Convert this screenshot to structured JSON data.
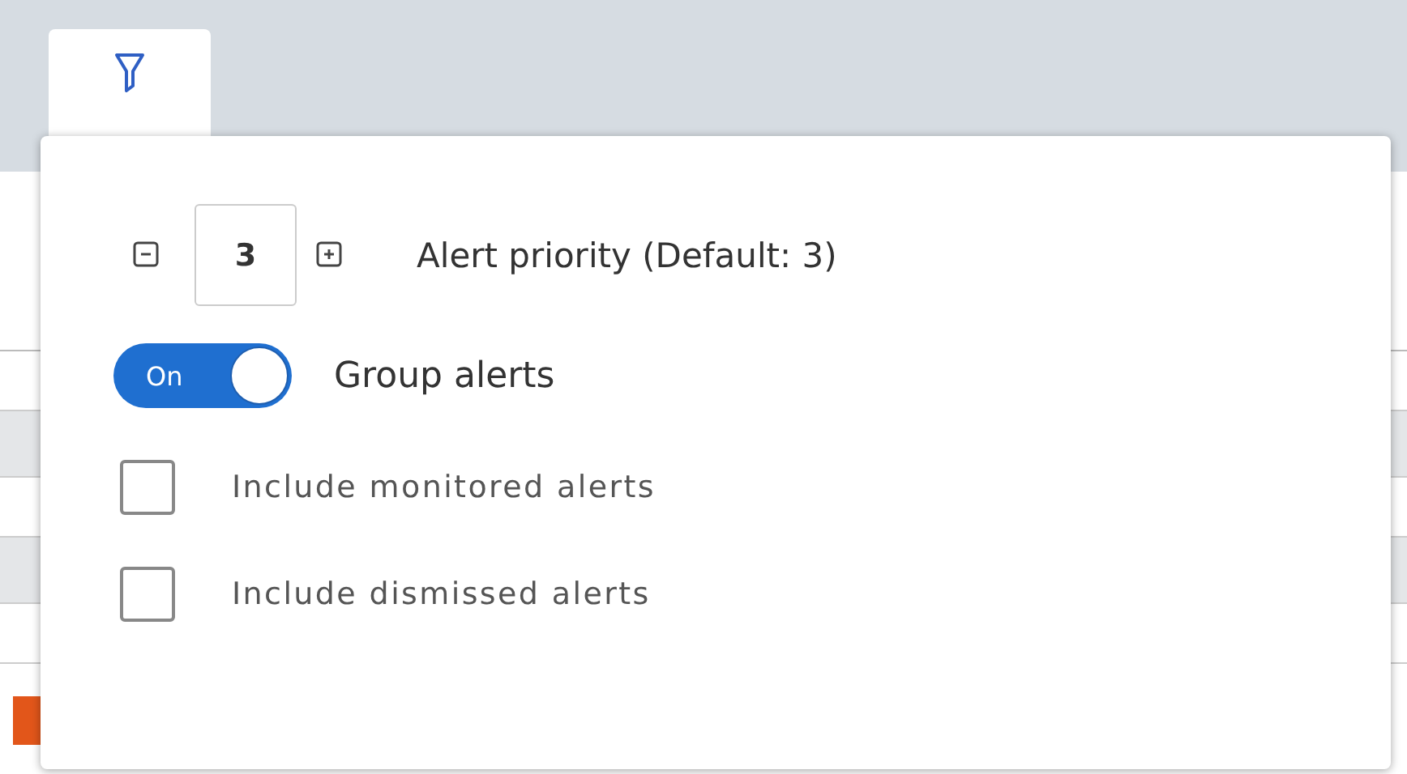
{
  "filter_tab": {
    "selected": true
  },
  "priority": {
    "value": "3",
    "label": "Alert priority (Default: 3)"
  },
  "group_toggle": {
    "on": true,
    "state_text": "On",
    "label": "Group alerts"
  },
  "checkboxes": [
    {
      "label": "Include monitored alerts",
      "checked": false
    },
    {
      "label": "Include dismissed alerts",
      "checked": false
    }
  ]
}
